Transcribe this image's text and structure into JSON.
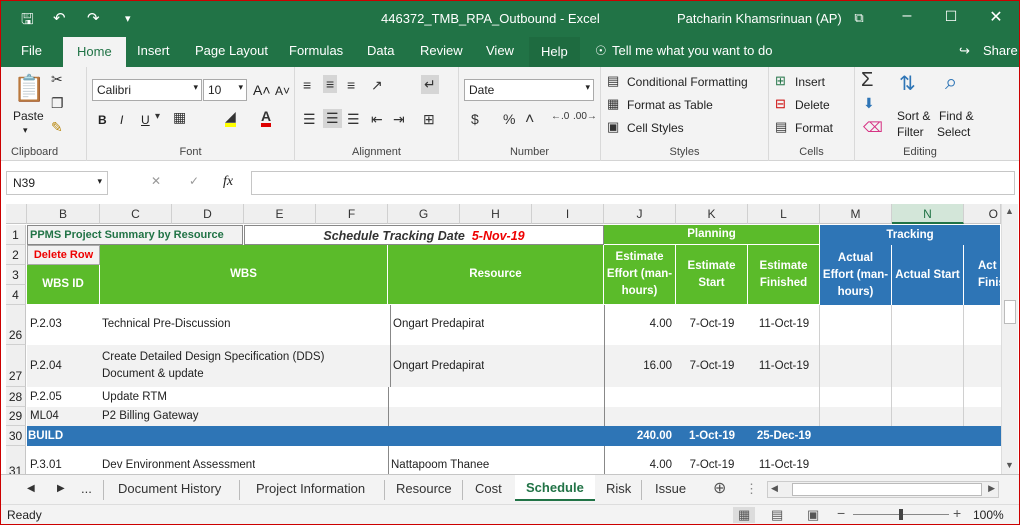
{
  "window": {
    "title": "446372_TMB_RPA_Outbound  -  Excel",
    "user": "Patcharin Khamsrinuan (AP)"
  },
  "tabs": [
    "File",
    "Home",
    "Insert",
    "Page Layout",
    "Formulas",
    "Data",
    "Review",
    "View",
    "Help"
  ],
  "tell_me": "Tell me what you want to do",
  "share": "Share",
  "ribbon": {
    "clipboard": {
      "paste": "Paste",
      "label": "Clipboard"
    },
    "font": {
      "name": "Calibri",
      "size": "10",
      "bold": "B",
      "italic": "I",
      "underline": "U",
      "label": "Font"
    },
    "alignment": {
      "label": "Alignment"
    },
    "number": {
      "format": "Date",
      "label": "Number"
    },
    "styles": {
      "conditional": "Conditional Formatting",
      "format_table": "Format as Table",
      "cell_styles": "Cell Styles",
      "label": "Styles"
    },
    "cells": {
      "insert": "Insert",
      "delete": "Delete",
      "format": "Format",
      "label": "Cells"
    },
    "editing": {
      "sort": "Sort &",
      "filter": "Filter",
      "find": "Find &",
      "select": "Select",
      "label": "Editing"
    }
  },
  "formula_bar": {
    "name_box": "N39",
    "fx": "fx",
    "value": ""
  },
  "columns": [
    "B",
    "C",
    "D",
    "E",
    "F",
    "G",
    "H",
    "I",
    "J",
    "K",
    "L",
    "M",
    "N",
    "O"
  ],
  "sheet": {
    "project_title": "PPMS Project Summary by Resource",
    "tracking_label": "Schedule Tracking Date",
    "tracking_date": "5-Nov-19",
    "delete_row": "Delete Row",
    "planning": "Planning",
    "tracking": "Tracking",
    "headers": {
      "wbs_id": "WBS ID",
      "wbs": "WBS",
      "resource": "Resource",
      "est_effort": "Estimate Effort (man-hours)",
      "est_start": "Estimate Start",
      "est_finished": "Estimate Finished",
      "act_effort": "Actual Effort (man-hours)",
      "act_start": "Actual Start",
      "act_finish": "Act Finis"
    },
    "row_numbers": {
      "r1": "1",
      "r2": "2",
      "r3": "3",
      "r4": "4",
      "r26": "26",
      "r27": "27",
      "r28": "28",
      "r29": "29",
      "r30": "30",
      "r31": "31"
    },
    "rows": [
      {
        "id": "P.2.03",
        "wbs": "Technical Pre-Discussion",
        "wbs2": "",
        "resource": "Ongart Predapirat",
        "effort": "4.00",
        "start": "7-Oct-19",
        "finish": "11-Oct-19"
      },
      {
        "id": "P.2.04",
        "wbs": "Create Detailed Design Specification (DDS)",
        "wbs2": "Document & update",
        "resource": "Ongart Predapirat",
        "effort": "16.00",
        "start": "7-Oct-19",
        "finish": "11-Oct-19"
      },
      {
        "id": "P.2.05",
        "wbs": "Update RTM",
        "wbs2": "",
        "resource": "",
        "effort": "",
        "start": "",
        "finish": ""
      },
      {
        "id": "ML04",
        "wbs": "P2 Billing Gateway",
        "wbs2": "",
        "resource": "",
        "effort": "",
        "start": "",
        "finish": ""
      },
      {
        "id": "BUILD",
        "wbs": "",
        "wbs2": "",
        "resource": "",
        "effort": "240.00",
        "start": "1-Oct-19",
        "finish": "25-Dec-19"
      },
      {
        "id": "P.3.01",
        "wbs": "Dev Environment Assessment",
        "wbs2": "",
        "resource": "Nattapoom Thanee",
        "effort": "4.00",
        "start": "7-Oct-19",
        "finish": "11-Oct-19"
      }
    ]
  },
  "sheet_tabs": [
    "Document History",
    "Project Information",
    "Resource",
    "Cost",
    "Schedule",
    "Risk",
    "Issue"
  ],
  "status": {
    "ready": "Ready",
    "zoom": "100%"
  }
}
